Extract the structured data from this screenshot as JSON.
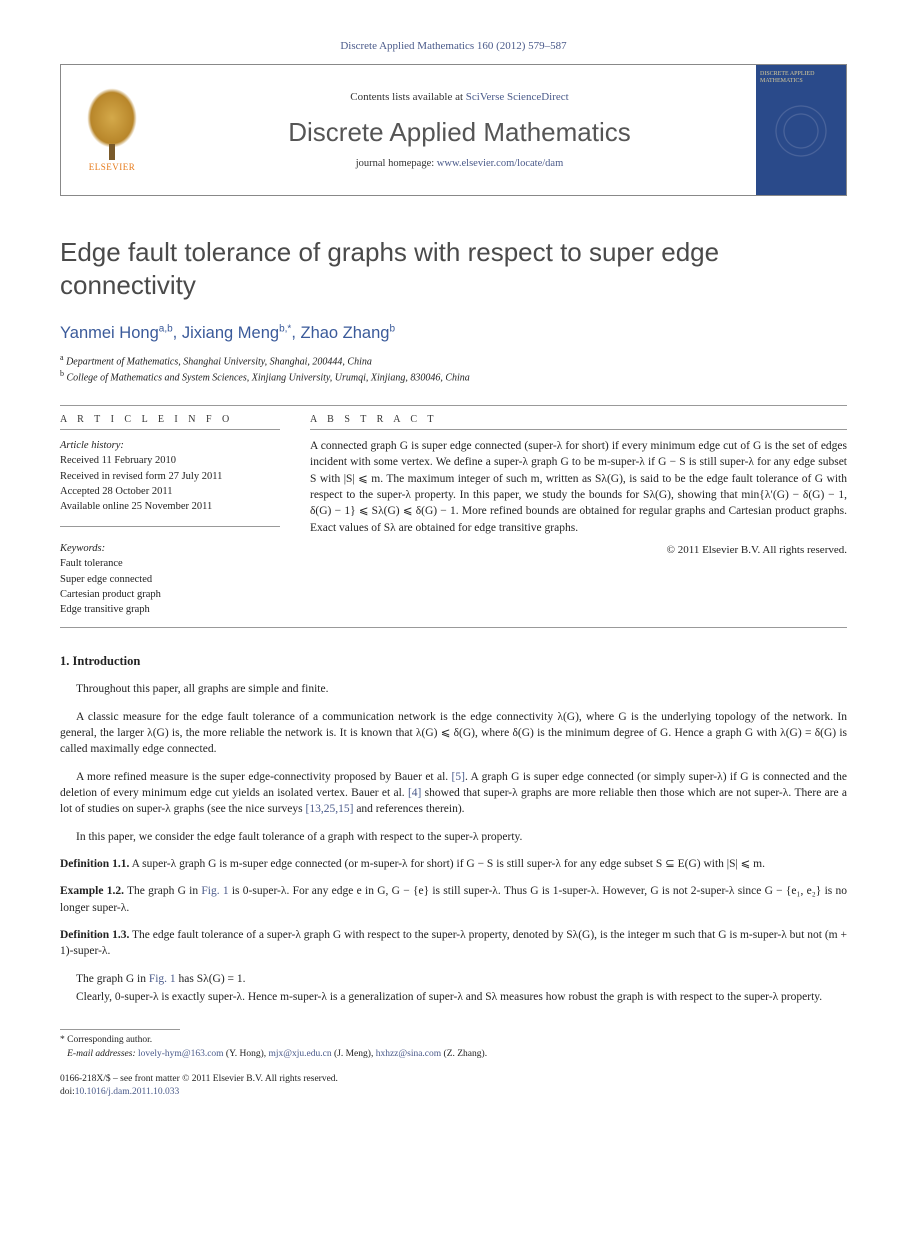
{
  "citation": "Discrete Applied Mathematics 160 (2012) 579–587",
  "header": {
    "publisher": "ELSEVIER",
    "contents_prefix": "Contents lists available at ",
    "contents_link": "SciVerse ScienceDirect",
    "journal": "Discrete Applied Mathematics",
    "homepage_prefix": "journal homepage: ",
    "homepage_link": "www.elsevier.com/locate/dam",
    "cover_title": "DISCRETE APPLIED MATHEMATICS"
  },
  "title": "Edge fault tolerance of graphs with respect to super edge connectivity",
  "authors_html": "Yanmei Hong<sup>a,b</sup>, Jixiang Meng<sup>b,*</sup>, Zhao Zhang<sup>b</sup>",
  "authors": [
    {
      "name": "Yanmei Hong",
      "marks": "a,b"
    },
    {
      "name": "Jixiang Meng",
      "marks": "b,*"
    },
    {
      "name": "Zhao Zhang",
      "marks": "b"
    }
  ],
  "affiliations": [
    {
      "mark": "a",
      "text": "Department of Mathematics, Shanghai University, Shanghai, 200444, China"
    },
    {
      "mark": "b",
      "text": "College of Mathematics and System Sciences, Xinjiang University, Urumqi, Xinjiang, 830046, China"
    }
  ],
  "article_info": {
    "heading": "A R T I C L E   I N F O",
    "history_label": "Article history:",
    "lines": [
      "Received 11 February 2010",
      "Received in revised form 27 July 2011",
      "Accepted 28 October 2011",
      "Available online 25 November 2011"
    ],
    "keywords_label": "Keywords:",
    "keywords": [
      "Fault tolerance",
      "Super edge connected",
      "Cartesian product graph",
      "Edge transitive graph"
    ]
  },
  "abstract": {
    "heading": "A B S T R A C T",
    "text": "A connected graph G is super edge connected (super-λ for short) if every minimum edge cut of G is the set of edges incident with some vertex. We define a super-λ graph G to be m-super-λ if G − S is still super-λ for any edge subset S with |S| ⩽ m. The maximum integer of such m, written as Sλ(G), is said to be the edge fault tolerance of G with respect to the super-λ property. In this paper, we study the bounds for Sλ(G), showing that min{λ′(G) − δ(G) − 1, δ(G) − 1} ⩽ Sλ(G) ⩽ δ(G) − 1. More refined bounds are obtained for regular graphs and Cartesian product graphs. Exact values of Sλ are obtained for edge transitive graphs.",
    "copyright": "© 2011 Elsevier B.V. All rights reserved."
  },
  "sections": {
    "intro_heading": "1. Introduction",
    "p1": "Throughout this paper, all graphs are simple and finite.",
    "p2": "A classic measure for the edge fault tolerance of a communication network is the edge connectivity λ(G), where G is the underlying topology of the network. In general, the larger λ(G) is, the more reliable the network is. It is known that λ(G) ⩽ δ(G), where δ(G) is the minimum degree of G. Hence a graph G with λ(G) = δ(G) is called maximally edge connected.",
    "p3a": "A more refined measure is the super edge-connectivity proposed by Bauer et al. ",
    "ref5": "[5]",
    "p3b": ". A graph G is super edge connected (or simply super-λ) if G is connected and the deletion of every minimum edge cut yields an isolated vertex. Bauer et al. ",
    "ref4": "[4]",
    "p3c": " showed that super-λ graphs are more reliable then those which are not super-λ. There are a lot of studies on super-λ graphs (see the nice surveys ",
    "refs_survey": "[13,25,15]",
    "p3d": " and references therein).",
    "p4": "In this paper, we consider the edge fault tolerance of a graph with respect to the super-λ property.",
    "def11_label": "Definition 1.1.",
    "def11_text": " A super-λ graph G is m-super edge connected (or m-super-λ for short) if G − S is still super-λ for any edge subset S ⊆ E(G) with |S| ⩽ m.",
    "ex12_label": "Example 1.2.",
    "ex12_a": " The graph G in ",
    "fig1a": "Fig. 1",
    "ex12_b": " is 0-super-λ. For any edge e in G, G − {e} is still super-λ. Thus G is 1-super-λ. However, G is not 2-super-λ since G − {e₁, e₂} is no longer super-λ.",
    "def13_label": "Definition 1.3.",
    "def13_text": " The edge fault tolerance of a super-λ graph G with respect to the super-λ property, denoted by Sλ(G), is the integer m such that G is m-super-λ but not (m + 1)-super-λ.",
    "p5a": "The graph G in ",
    "fig1b": "Fig. 1",
    "p5b": " has Sλ(G) = 1.",
    "p6": "Clearly, 0-super-λ is exactly super-λ. Hence m-super-λ is a generalization of super-λ and Sλ measures how robust the graph is with respect to the super-λ property."
  },
  "footnotes": {
    "corr_mark": "*",
    "corr_text": "Corresponding author.",
    "email_label": "E-mail addresses:",
    "emails": [
      {
        "addr": "lovely-hym@163.com",
        "who": "(Y. Hong)"
      },
      {
        "addr": "mjx@xju.edu.cn",
        "who": "(J. Meng)"
      },
      {
        "addr": "hxhzz@sina.com",
        "who": "(Z. Zhang)"
      }
    ]
  },
  "bottom": {
    "line1": "0166-218X/$ – see front matter © 2011 Elsevier B.V. All rights reserved.",
    "doi_label": "doi:",
    "doi": "10.1016/j.dam.2011.10.033"
  }
}
